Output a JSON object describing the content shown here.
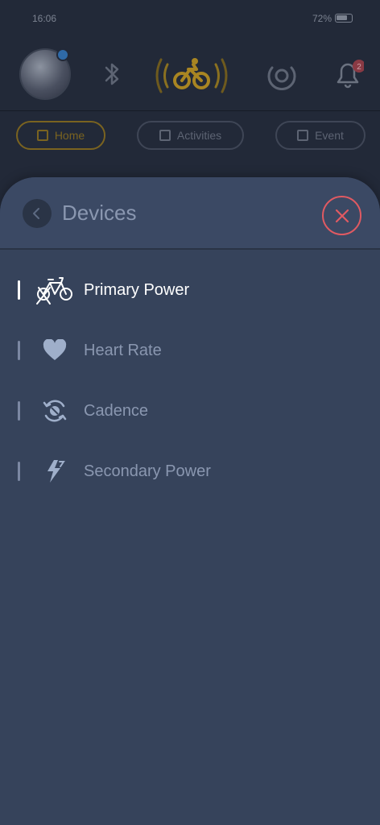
{
  "status_bar": {
    "time": "16:06",
    "battery": "72%"
  },
  "nav": {
    "tabs": [
      {
        "label": "Home",
        "active": true
      },
      {
        "label": "Activities",
        "active": false
      },
      {
        "label": "Event",
        "active": false
      }
    ]
  },
  "notifications": {
    "count": "2"
  },
  "devices_panel": {
    "title": "Devices",
    "items": [
      {
        "label": "Primary Power",
        "icon": "bike-trainer-icon",
        "active": true
      },
      {
        "label": "Heart Rate",
        "icon": "heart-icon",
        "active": false
      },
      {
        "label": "Cadence",
        "icon": "cadence-icon",
        "active": false
      },
      {
        "label": "Secondary Power",
        "icon": "power-bolt-icon",
        "active": false
      }
    ]
  },
  "colors": {
    "accent": "#e05a62",
    "brand_yellow": "#d9a72a",
    "sheet_bg": "#36435b",
    "inactive_text": "#8a97b0"
  }
}
